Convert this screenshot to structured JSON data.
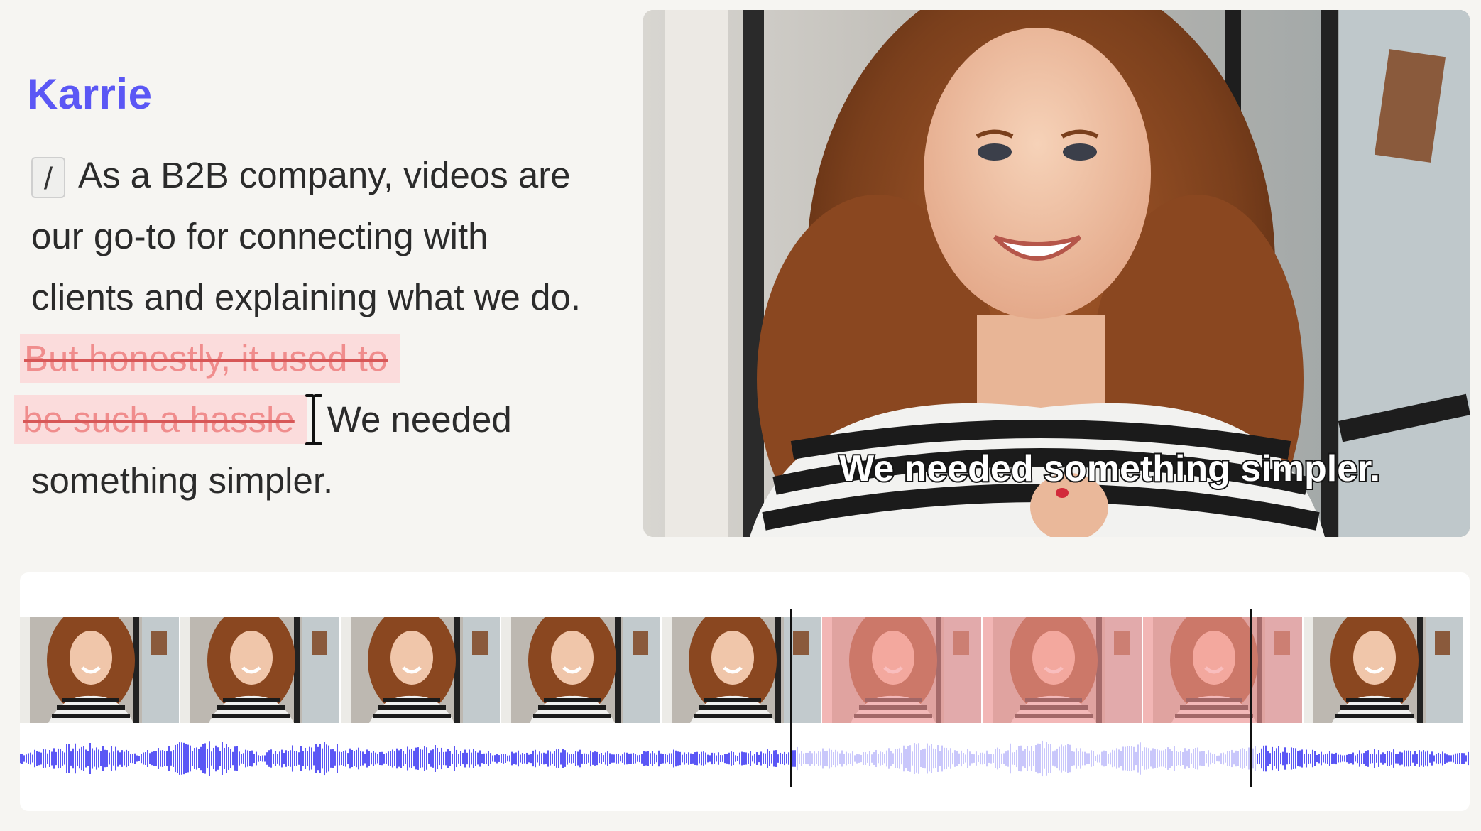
{
  "speaker": {
    "name": "Karrie"
  },
  "transcript": {
    "slash_chip": "/",
    "text_before": "As a B2B company, videos are our go-to for connecting with clients and explaining what we do.",
    "struck_line1": "But honestly, it used to",
    "struck_line2": "be such a hassle",
    "text_after_part1": "We needed",
    "text_after_part2": "something simpler."
  },
  "video": {
    "caption": "We needed something simpler."
  },
  "timeline": {
    "frames": [
      {
        "state": "kept"
      },
      {
        "state": "kept"
      },
      {
        "state": "kept"
      },
      {
        "state": "kept"
      },
      {
        "state": "kept"
      },
      {
        "state": "cut"
      },
      {
        "state": "cut"
      },
      {
        "state": "cut"
      },
      {
        "state": "kept"
      }
    ],
    "cut_region": {
      "start_fraction": 0.535,
      "end_fraction": 0.853
    },
    "colors": {
      "kept_wave": "#5b57f5",
      "cut_wave": "#c9c7fb",
      "cut_overlay": "#f59a9a"
    }
  },
  "colors": {
    "accent": "#5b57f5",
    "strike": "#d75757",
    "strike_bg": "#fbdcdc"
  }
}
